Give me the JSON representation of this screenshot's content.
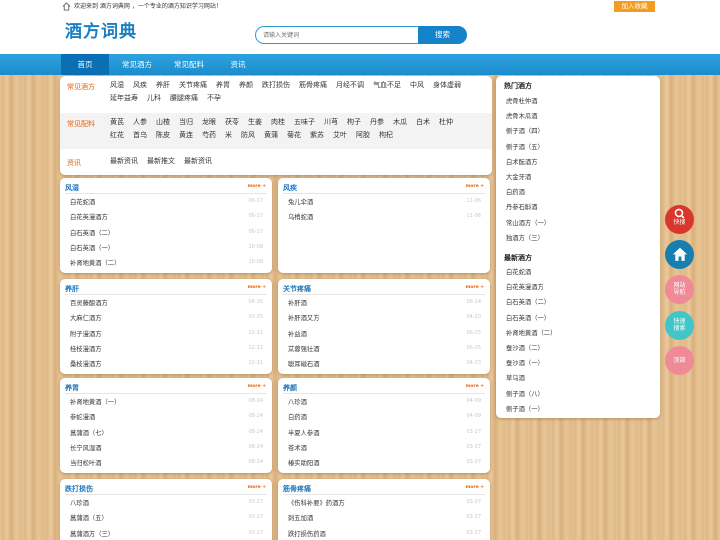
{
  "topbar": {
    "welcome": "欢迎来到 酒方词典网 ，一个专业的酒方知识学习网站！",
    "favorite": "加入收藏"
  },
  "header": {
    "logo": "酒方词典",
    "search_placeholder": "请输入关键词",
    "search_button": "搜索"
  },
  "nav": {
    "items": [
      "首页",
      "常见酒方",
      "常见配料",
      "资讯"
    ]
  },
  "categories": {
    "recipes": {
      "label": "常见酒方",
      "links": [
        "风湿",
        "风疾",
        "养肝",
        "关节疼痛",
        "养胃",
        "养颜",
        "跌打损伤",
        "筋骨疼痛",
        "月经不调",
        "气血不足",
        "中风",
        "身体虚弱",
        "延年益寿",
        "儿科",
        "腰腿疼痛",
        "不孕"
      ]
    },
    "ingredients": {
      "label": "常见配料",
      "links": [
        "黄芪",
        "人参",
        "山楂",
        "当归",
        "龙眼",
        "茯苓",
        "生姜",
        "肉桂",
        "五味子",
        "川芎",
        "枸子",
        "丹参",
        "木瓜",
        "白术",
        "杜仲",
        "红花",
        "首乌",
        "陈皮",
        "黄连",
        "芍药",
        "米",
        "防风",
        "黄蒲",
        "菊花",
        "紫苏",
        "艾叶",
        "阿胶",
        "枸杞"
      ]
    },
    "news": {
      "label": "资讯",
      "links": [
        "最新资讯",
        "最新推文",
        "最新资讯"
      ]
    }
  },
  "more_label": "more +",
  "columns": [
    {
      "title": "风湿",
      "items": [
        {
          "name": "白花蛇酒",
          "date": "06-17"
        },
        {
          "name": "白花英漫酒方",
          "date": "06-17"
        },
        {
          "name": "白石英酒（二）",
          "date": "06-17"
        },
        {
          "name": "白石英酒（一）",
          "date": "10-08"
        },
        {
          "name": "补肾地黄酒（二）",
          "date": "10-08"
        }
      ]
    },
    {
      "title": "风疾",
      "items": [
        {
          "name": "兔儿伞酒",
          "date": "11-06"
        },
        {
          "name": "乌梢蛇酒",
          "date": "11-06"
        }
      ]
    },
    {
      "title": "养肝",
      "items": [
        {
          "name": "百灵藤酿酒方",
          "date": "04-26"
        },
        {
          "name": "大麻仁酒方",
          "date": "03-25"
        },
        {
          "name": "附子漫酒方",
          "date": "12-21"
        },
        {
          "name": "桂枝漫酒方",
          "date": "12-21"
        },
        {
          "name": "桑枝漫酒方",
          "date": "12-21"
        }
      ]
    },
    {
      "title": "关节疼痛",
      "items": [
        {
          "name": "补肝酒",
          "date": "06-14"
        },
        {
          "name": "补肝酒又方",
          "date": "04-20"
        },
        {
          "name": "补益酒",
          "date": "06-25"
        },
        {
          "name": "苁蓉强壮酒",
          "date": "06-25"
        },
        {
          "name": "聪耳磁石酒",
          "date": "04-23"
        }
      ]
    },
    {
      "title": "养胃",
      "items": [
        {
          "name": "补肾地黄酒（一）",
          "date": "08-24"
        },
        {
          "name": "参蛇漫酒",
          "date": "08-24"
        },
        {
          "name": "菖蒲酒（七）",
          "date": "08-24"
        },
        {
          "name": "长宁风湿酒",
          "date": "08-24"
        },
        {
          "name": "当归松叶酒",
          "date": "08-24"
        }
      ]
    },
    {
      "title": "养颜",
      "items": [
        {
          "name": "八珍酒",
          "date": "04-09"
        },
        {
          "name": "白药酒",
          "date": "04-09"
        },
        {
          "name": "半夏人参酒",
          "date": "03-27"
        },
        {
          "name": "苍术酒",
          "date": "03-27"
        },
        {
          "name": "椿实助阳酒",
          "date": "03-27"
        }
      ]
    },
    {
      "title": "跌打损伤",
      "items": [
        {
          "name": "八珍酒",
          "date": "03-27"
        },
        {
          "name": "菖蒲酒（五）",
          "date": "03-27"
        },
        {
          "name": "菖蒲酒方（三）",
          "date": "03-27"
        }
      ]
    },
    {
      "title": "筋骨疼痛",
      "items": [
        {
          "name": "《伤科补要》药酒方",
          "date": "03-27"
        },
        {
          "name": "刺五加酒",
          "date": "03-27"
        },
        {
          "name": "跌打损伤药酒",
          "date": "03-27"
        }
      ]
    }
  ],
  "sidebar": {
    "hot_title": "热门酒方",
    "hot": [
      "虎骨杜仲酒",
      "虎骨木瓜酒",
      "侧子酒（四）",
      "侧子酒（五）",
      "白术酝酒方",
      "大金牙酒",
      "白药酒",
      "丹参石斛酒",
      "常山酒方（一）",
      "独酒方（三）"
    ],
    "new_title": "最新酒方",
    "new": [
      "白花蛇酒",
      "白花英漫酒方",
      "白石英酒（二）",
      "白石英酒（一）",
      "补肾地黄酒（二）",
      "蚕沙酒（二）",
      "蚕沙酒（一）",
      "草乌酒",
      "侧子酒（八）",
      "侧子酒（一）"
    ]
  },
  "float_buttons": [
    {
      "lines": [
        "快搜"
      ],
      "color": "#d9372c"
    },
    {
      "lines": [],
      "color": "#167fb0"
    },
    {
      "lines": [
        "网站",
        "导航"
      ],
      "color": "#f08a97"
    },
    {
      "lines": [
        "快速",
        "搜索"
      ],
      "color": "#3ec6c8"
    },
    {
      "lines": [
        "顶部"
      ],
      "color": "#f08a97"
    }
  ]
}
